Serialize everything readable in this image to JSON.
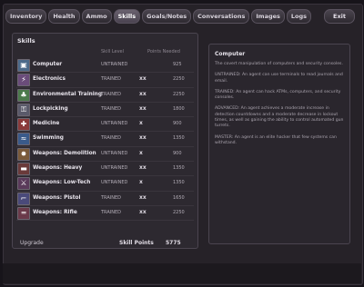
{
  "tabs": [
    {
      "label": "Inventory",
      "active": false
    },
    {
      "label": "Health",
      "active": false
    },
    {
      "label": "Ammo",
      "active": false
    },
    {
      "label": "Skills",
      "active": true
    },
    {
      "label": "Goals/Notes",
      "active": false
    },
    {
      "label": "Conversations",
      "active": false
    },
    {
      "label": "Images",
      "active": false
    },
    {
      "label": "Logs",
      "active": false
    }
  ],
  "exit_label": "Exit",
  "skills_panel": {
    "title": "Skills",
    "col_level": "Skill Level",
    "col_needed": "Points Needed",
    "rows": [
      {
        "name": "Computer",
        "level": "UNTRAINED",
        "modifier": "",
        "cost": "925",
        "icon": "computer-icon",
        "icon_glyph": "▣",
        "icon_color": "#4c6a8a"
      },
      {
        "name": "Electronics",
        "level": "TRAINED",
        "modifier": "xx",
        "cost": "2250",
        "icon": "electronics-icon",
        "icon_glyph": "⚡",
        "icon_color": "#6a4c7a"
      },
      {
        "name": "Environmental Training",
        "level": "TRAINED",
        "modifier": "xx",
        "cost": "2250",
        "icon": "environment-icon",
        "icon_glyph": "♣",
        "icon_color": "#4c7a4c"
      },
      {
        "name": "Lockpicking",
        "level": "TRAINED",
        "modifier": "xx",
        "cost": "1800",
        "icon": "lockpick-icon",
        "icon_glyph": "⚿",
        "icon_color": "#5a5a6a"
      },
      {
        "name": "Medicine",
        "level": "UNTRAINED",
        "modifier": "x",
        "cost": "900",
        "icon": "medicine-icon",
        "icon_glyph": "✚",
        "icon_color": "#8a3a3a"
      },
      {
        "name": "Swimming",
        "level": "TRAINED",
        "modifier": "xx",
        "cost": "1350",
        "icon": "swimming-icon",
        "icon_glyph": "≈",
        "icon_color": "#3a5a8a"
      },
      {
        "name": "Weapons: Demolition",
        "level": "UNTRAINED",
        "modifier": "x",
        "cost": "900",
        "icon": "demolition-icon",
        "icon_glyph": "✸",
        "icon_color": "#7a5a3a"
      },
      {
        "name": "Weapons: Heavy",
        "level": "UNTRAINED",
        "modifier": "xx",
        "cost": "1350",
        "icon": "heavy-weapon-icon",
        "icon_glyph": "▬",
        "icon_color": "#6a3a3a"
      },
      {
        "name": "Weapons: Low-Tech",
        "level": "UNTRAINED",
        "modifier": "x",
        "cost": "1350",
        "icon": "lowtech-weapon-icon",
        "icon_glyph": "⚔",
        "icon_color": "#5a3a5a"
      },
      {
        "name": "Weapons: Pistol",
        "level": "TRAINED",
        "modifier": "xx",
        "cost": "1650",
        "icon": "pistol-icon",
        "icon_glyph": "⌐",
        "icon_color": "#4a4a7a"
      },
      {
        "name": "Weapons: Rifle",
        "level": "TRAINED",
        "modifier": "xx",
        "cost": "2250",
        "icon": "rifle-icon",
        "icon_glyph": "═",
        "icon_color": "#6a3a4a"
      }
    ]
  },
  "footer": {
    "upgrade_label": "Upgrade",
    "skill_points_label": "Skill Points",
    "skill_points_value": "5775"
  },
  "description": {
    "title": "Computer",
    "paragraphs": [
      "The covert manipulation of computers and security consoles.",
      "UNTRAINED: An agent can use terminals to read journals and email.",
      "TRAINED: An agent can hack ATMs, computers, and security consoles.",
      "ADVANCED: An agent achieves a moderate increase in detection countdowns and a moderate decrease in lockout times, as well as gaining the ability to control automated gun turrets.",
      "MASTER: An agent is an elite hacker that few systems can withstand."
    ]
  }
}
